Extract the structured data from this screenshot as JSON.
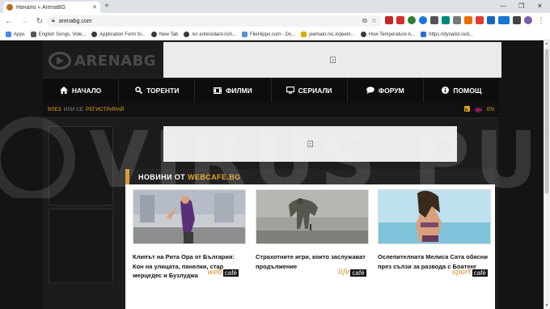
{
  "browser": {
    "tab_title": "Начало « ArenaBG",
    "url": "arenabg.com",
    "bookmarks": [
      {
        "label": "Apps",
        "color": "#4285f4"
      },
      {
        "label": "English Songs, Vide...",
        "color": "#555555"
      },
      {
        "label": "Application Form fo...",
        "color": "#3a3a3a"
      },
      {
        "label": "New Tab",
        "color": "#3a3a3a"
      },
      {
        "label": "An antioxidant-rich...",
        "color": "#3a3a3a"
      },
      {
        "label": "FileHippo.com - Do...",
        "color": "#5b8fd0"
      },
      {
        "label": "jeemain.nic.in/jeem...",
        "color": "#e0a800"
      },
      {
        "label": "How Temperature A...",
        "color": "#3a3a3a"
      },
      {
        "label": "https://dynalist.io/d...",
        "color": "#2b6cd6"
      }
    ]
  },
  "site": {
    "logo_text": "ARENABG",
    "nav": [
      {
        "label": "НАЧАЛО",
        "icon": "home-icon"
      },
      {
        "label": "ТОРЕНТИ",
        "icon": "search-icon"
      },
      {
        "label": "ФИЛМИ",
        "icon": "film-icon"
      },
      {
        "label": "СЕРИАЛИ",
        "icon": "monitor-icon"
      },
      {
        "label": "ФОРУМ",
        "icon": "chat-icon"
      },
      {
        "label": "ПОМОЩ",
        "icon": "info-icon"
      }
    ],
    "login": {
      "login_link": "ВЛЕЗ",
      "or_text": "ИЛИ СЕ",
      "register_link": "РЕГИСТРИРАЙ",
      "language": "EN"
    },
    "news": {
      "heading_prefix": "НОВИНИ ОТ",
      "heading_brand": "WEBCAFE.BG",
      "items": [
        {
          "title": "Клипът на Рита Ора от България: Кон на улицата, панелки, стар мерцедес и Бузлуджа",
          "source_prefix": "web",
          "source_box": "café"
        },
        {
          "title": "Страхотните игри, които заслужават продължение",
          "source_prefix": "life",
          "source_box": "café"
        },
        {
          "title": "Ослепителната Мелиса Сата обясни през сълзи за развода с Боатенг",
          "source_prefix": "sport",
          "source_box": "café"
        }
      ]
    },
    "watermark": "VIRUS PUP"
  },
  "colors": {
    "accent": "#e8a21f",
    "nav_bg": "#0d0d0d",
    "page_bg": "#1c1c1c"
  }
}
